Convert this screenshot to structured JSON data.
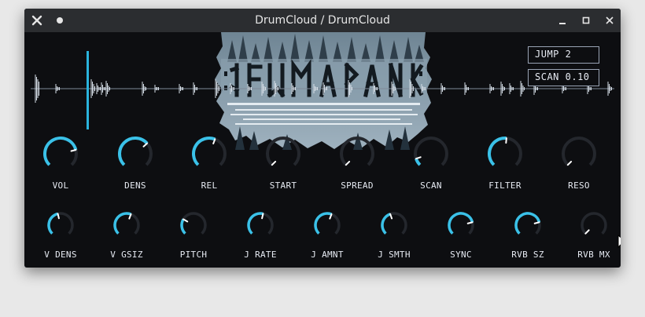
{
  "window": {
    "title": "DrumCloud / DrumCloud"
  },
  "display": {
    "jump": "JUMP 2",
    "scan": "SCAN 0.10"
  },
  "knobs_row1": [
    {
      "label": "VOL",
      "value": 0.78
    },
    {
      "label": "DENS",
      "value": 0.68
    },
    {
      "label": "REL",
      "value": 0.58
    },
    {
      "label": "START",
      "value": 0.0
    },
    {
      "label": "SPREAD",
      "value": 0.0
    },
    {
      "label": "SCAN",
      "value": 0.1
    },
    {
      "label": "FILTER",
      "value": 0.52
    },
    {
      "label": "RESO",
      "value": 0.0
    }
  ],
  "knobs_row2": [
    {
      "label": "V DENS",
      "value": 0.45
    },
    {
      "label": "V GSIZ",
      "value": 0.58
    },
    {
      "label": "PITCH",
      "value": 0.28
    },
    {
      "label": "J RATE",
      "value": 0.55
    },
    {
      "label": "J AMNT",
      "value": 0.58
    },
    {
      "label": "J SMTH",
      "value": 0.43
    },
    {
      "label": "SYNC",
      "value": 0.78
    },
    {
      "label": "RVB SZ",
      "value": 0.78
    },
    {
      "label": "RVB MX",
      "value": 0.0
    }
  ],
  "colors": {
    "accent": "#3ac1e8",
    "track": "#24272d",
    "background": "#0d0e11",
    "playhead": "#2ab3dd"
  }
}
